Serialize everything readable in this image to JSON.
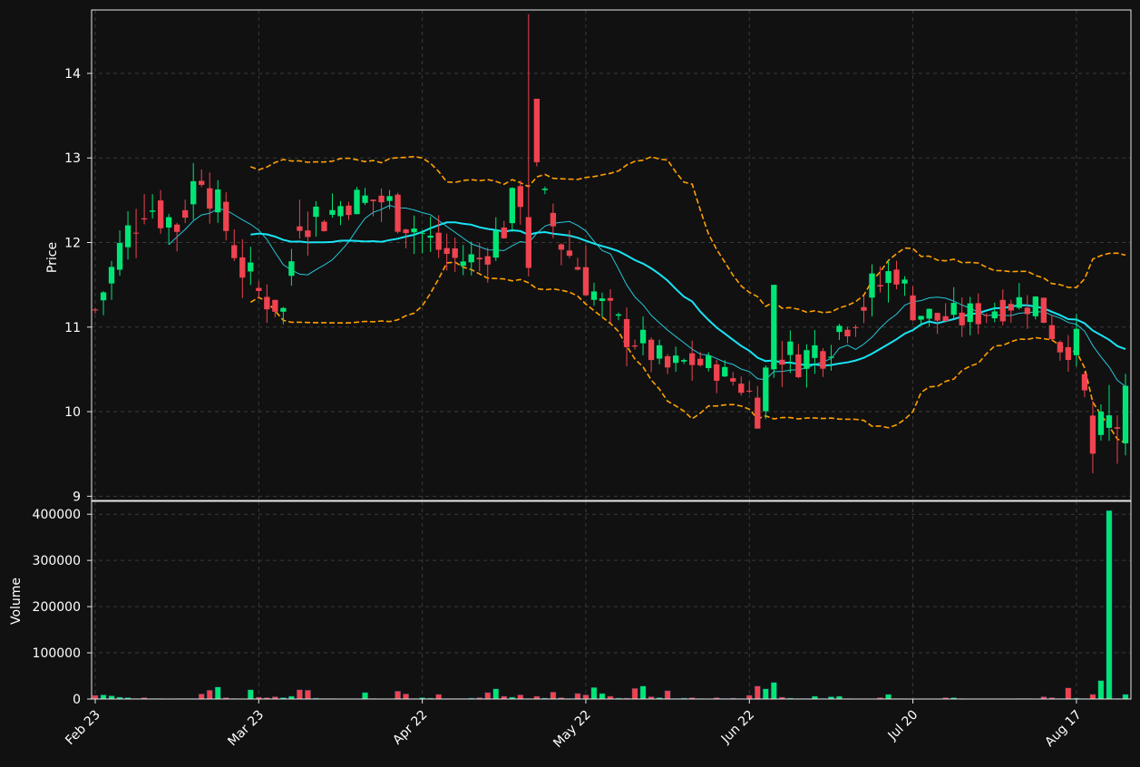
{
  "colors": {
    "background": "#111111",
    "panel": "#111111",
    "frame": "#e8e8e8",
    "grid": "#3a3a3a",
    "text": "#ffffff",
    "up": "#00e676",
    "down": "#ef4350",
    "ma_fast": "#26c6da",
    "ma_slow": "#18e4f4",
    "bands": "#ffa000"
  },
  "chart_data": [
    {
      "type": "candlestick",
      "ylabel": "Price",
      "ylim": [
        8.95,
        14.75
      ],
      "y_ticks": [
        9,
        10,
        11,
        12,
        13,
        14
      ],
      "x_ticks": [
        {
          "label": "Feb 23",
          "index": 0
        },
        {
          "label": "Mar 23",
          "index": 20
        },
        {
          "label": "Apr 22",
          "index": 40
        },
        {
          "label": "May 22",
          "index": 60
        },
        {
          "label": "Jun 22",
          "index": 80
        },
        {
          "label": "Jul 20",
          "index": 100
        },
        {
          "label": "Aug 17",
          "index": 120
        }
      ],
      "grid": true,
      "overlays": [
        "moving average (fast)",
        "moving average (slow)",
        "upper band",
        "lower band"
      ],
      "anchors": [
        [
          0,
          11.2,
          0.3
        ],
        [
          3,
          11.9,
          0.6
        ],
        [
          6,
          12.5,
          0.6
        ],
        [
          10,
          12.2,
          0.5
        ],
        [
          13,
          12.9,
          0.6
        ],
        [
          15,
          12.4,
          0.5
        ],
        [
          18,
          11.7,
          0.5
        ],
        [
          20,
          11.4,
          0.5
        ],
        [
          23,
          11.2,
          0.3
        ],
        [
          25,
          12.4,
          0.7
        ],
        [
          28,
          12.3,
          0.5
        ],
        [
          31,
          12.5,
          0.4
        ],
        [
          35,
          12.5,
          0.5
        ],
        [
          38,
          12.3,
          0.6
        ],
        [
          41,
          12.0,
          0.5
        ],
        [
          44,
          11.8,
          0.4
        ],
        [
          47,
          11.8,
          0.4
        ],
        [
          50,
          12.2,
          0.5
        ],
        [
          53,
          12.8,
          0.6
        ],
        [
          55,
          12.4,
          0.6
        ],
        [
          57,
          12.0,
          0.5
        ],
        [
          60,
          11.6,
          0.6
        ],
        [
          62,
          11.2,
          0.6
        ],
        [
          64,
          11.0,
          0.5
        ],
        [
          67,
          10.8,
          0.4
        ],
        [
          70,
          10.5,
          0.4
        ],
        [
          73,
          10.6,
          0.4
        ],
        [
          76,
          10.5,
          0.3
        ],
        [
          79,
          10.3,
          0.3
        ],
        [
          81,
          10.1,
          0.6
        ],
        [
          83,
          10.8,
          0.6
        ],
        [
          86,
          10.6,
          0.4
        ],
        [
          89,
          10.8,
          0.6
        ],
        [
          92,
          11.1,
          0.5
        ],
        [
          95,
          11.4,
          0.6
        ],
        [
          98,
          11.7,
          0.5
        ],
        [
          100,
          11.2,
          0.3
        ],
        [
          103,
          11.1,
          0.4
        ],
        [
          106,
          11.1,
          0.4
        ],
        [
          109,
          11.2,
          0.4
        ],
        [
          112,
          11.3,
          0.4
        ],
        [
          115,
          11.3,
          0.4
        ],
        [
          118,
          10.8,
          0.4
        ],
        [
          120,
          10.8,
          0.4
        ],
        [
          122,
          9.5,
          0.6
        ],
        [
          124,
          9.8,
          0.9
        ],
        [
          125,
          9.9,
          0.9
        ]
      ],
      "big_candles": [
        {
          "index": 54,
          "open": 13.7,
          "close": 12.95,
          "high": 13.7,
          "low": 12.9
        },
        {
          "index": 53,
          "open": 12.3,
          "close": 11.7,
          "high": 14.7,
          "low": 11.6
        },
        {
          "index": 83,
          "open": 10.5,
          "close": 11.5,
          "high": 11.5,
          "low": 10.4
        }
      ]
    },
    {
      "type": "bar",
      "ylabel": "Volume",
      "ylim": [
        0,
        420000
      ],
      "y_ticks": [
        0,
        100000,
        200000,
        300000,
        400000
      ],
      "y_tick_labels": [
        "0",
        "100000",
        "200000",
        "300000",
        "400000"
      ],
      "grid": true,
      "values": [
        8000,
        9000,
        7000,
        4000,
        3000,
        1000,
        3000,
        1000,
        1000,
        500,
        1000,
        1000,
        1000,
        11000,
        19000,
        26000,
        3000,
        1000,
        500,
        20000,
        4000,
        3000,
        5000,
        3000,
        6000,
        20000,
        19000,
        2000,
        1000,
        1000,
        500,
        500,
        500,
        14000,
        1000,
        500,
        500,
        17000,
        11000,
        1000,
        3000,
        2000,
        10000,
        1000,
        1000,
        1000,
        2000,
        3000,
        14000,
        22000,
        6000,
        4000,
        9000,
        1000,
        6000,
        2000,
        15000,
        3000,
        1000,
        12000,
        9000,
        25000,
        12000,
        6000,
        2000,
        2000,
        23000,
        28000,
        5000,
        3000,
        18000,
        1000,
        2000,
        3000,
        1000,
        500,
        3000,
        1000,
        2000,
        1000,
        8000,
        28000,
        22000,
        36000,
        4000,
        2000,
        1000,
        1000,
        6000,
        1000,
        5000,
        6000,
        1000,
        500,
        500,
        500,
        3000,
        10000,
        1000,
        1000,
        500,
        500,
        500,
        500,
        3000,
        3000,
        1000,
        500,
        500,
        500,
        500,
        500,
        500,
        1000,
        1000,
        500,
        5000,
        3000,
        1000,
        24000,
        2000,
        1000,
        10000,
        40000,
        408000,
        1000,
        10000
      ]
    }
  ]
}
